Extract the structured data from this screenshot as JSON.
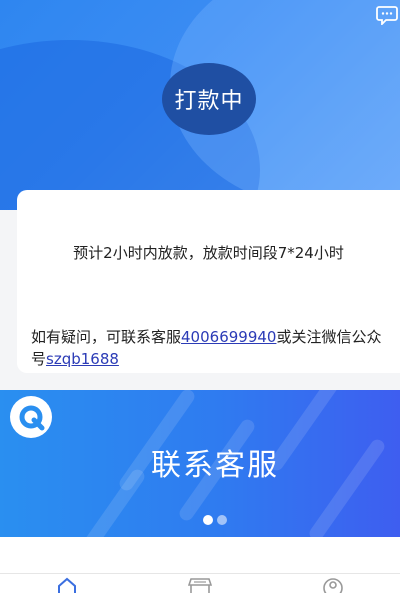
{
  "status": {
    "label": "打款中"
  },
  "notice": {
    "text": "预计2小时内放款，放款时间段7*24小时"
  },
  "contact": {
    "prefix": "如有疑问，可联系客服",
    "phone": "4006699940",
    "middle": "或关注微信公众号",
    "wechat": "szqb1688"
  },
  "banner": {
    "title": "联系客服",
    "slides": 2,
    "active_slide": 1
  },
  "tabs": [
    {
      "icon": "home-icon",
      "active": true
    },
    {
      "icon": "store-icon",
      "active": false
    },
    {
      "icon": "user-icon",
      "active": false
    }
  ],
  "colors": {
    "primary": "#2e86f0",
    "status_circle": "#1f4fa3",
    "link": "#2b3bb6",
    "tab_active": "#3b6fe0",
    "tab_inactive": "#999999"
  }
}
